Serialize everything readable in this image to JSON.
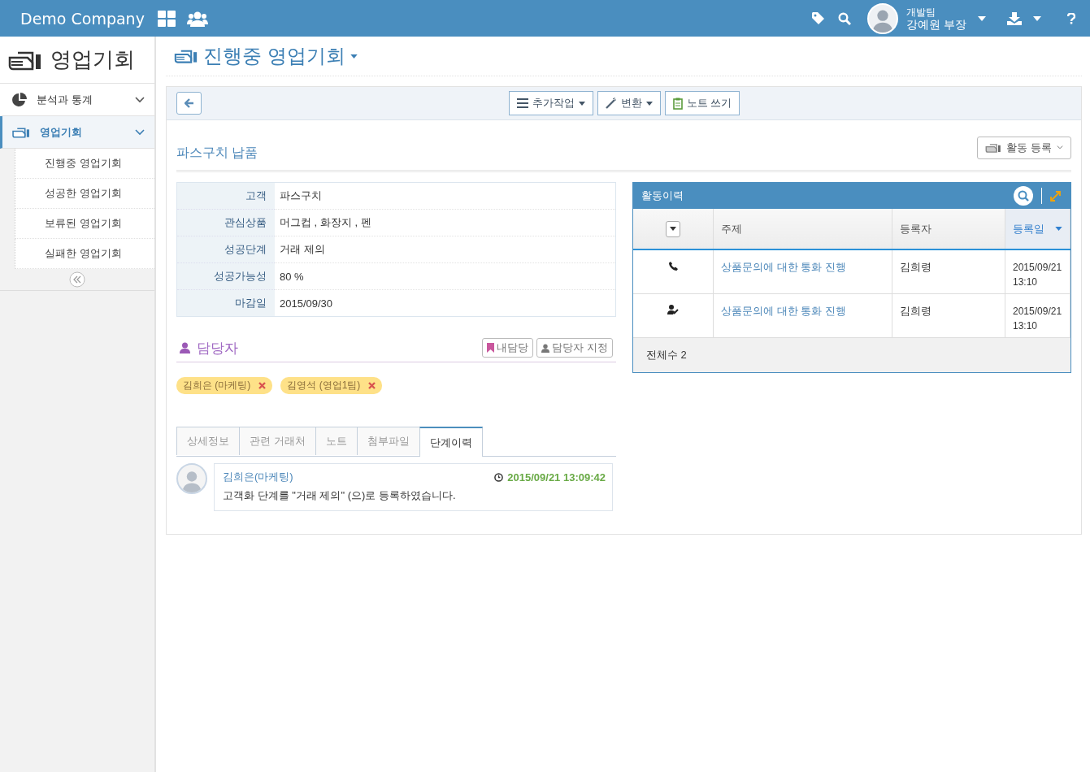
{
  "header": {
    "brand": "Demo Company",
    "user": {
      "team": "개발팀",
      "name": "강예원 부장"
    }
  },
  "sidebar": {
    "title": "영업기회",
    "items": [
      {
        "label": "분석과 통계",
        "expanded": false,
        "selected": false
      },
      {
        "label": "영업기회",
        "expanded": true,
        "selected": true,
        "children": [
          {
            "label": "진행중 영업기회",
            "selected": false
          },
          {
            "label": "성공한 영업기회",
            "selected": false
          },
          {
            "label": "보류된 영업기회",
            "selected": false
          },
          {
            "label": "실패한 영업기회",
            "selected": false
          }
        ]
      }
    ]
  },
  "page_title": "진행중 영업기회",
  "toolbar": [
    {
      "label": "추가작업"
    },
    {
      "label": "변환"
    },
    {
      "label": "노트 쓰기"
    }
  ],
  "opportunity": {
    "title": "파스구치 납품",
    "activity_button": "활동 등록",
    "fields": [
      {
        "label": "고객",
        "value": "파스구치"
      },
      {
        "label": "관심상품",
        "value": "머그컵 ,  화장지 ,  펜"
      },
      {
        "label": "성공단계",
        "value": "거래 제의"
      },
      {
        "label": "성공가능성",
        "value": "80 %"
      },
      {
        "label": "마감일",
        "value": "2015/09/30"
      }
    ]
  },
  "owners": {
    "title": "담당자",
    "buttons": [
      {
        "label": "내담당"
      },
      {
        "label": "담당자 지정"
      }
    ],
    "tags": [
      {
        "label": "김희은 (마케팅)"
      },
      {
        "label": "김영석 (영업1팀)"
      }
    ]
  },
  "tabs": [
    {
      "label": "상세정보",
      "selected": false
    },
    {
      "label": "관련 거래처",
      "selected": false
    },
    {
      "label": "노트",
      "selected": false
    },
    {
      "label": "첨부파일",
      "selected": false
    },
    {
      "label": "단계이력",
      "selected": true
    }
  ],
  "history": [
    {
      "author": "김희은(마케팅)",
      "time": "2015/09/21 13:09:42",
      "message": "고객화 단계를 \"거래 제의\" (으)로 등록하였습니다."
    }
  ],
  "activity": {
    "title": "활동이력",
    "columns": [
      {
        "label": "주제",
        "sorted": false
      },
      {
        "label": "등록자",
        "sorted": false
      },
      {
        "label": "등록일",
        "sorted": true
      }
    ],
    "rows": [
      {
        "kind": "call",
        "subject": "상품문의에 대한 통화 진행",
        "author": "김희령",
        "date": "2015/09/21 13:10"
      },
      {
        "kind": "meeting",
        "subject": "상품문의에 대한 통화 진행",
        "author": "김희령",
        "date": "2015/09/21 13:10"
      }
    ],
    "total": "전체수 2"
  }
}
